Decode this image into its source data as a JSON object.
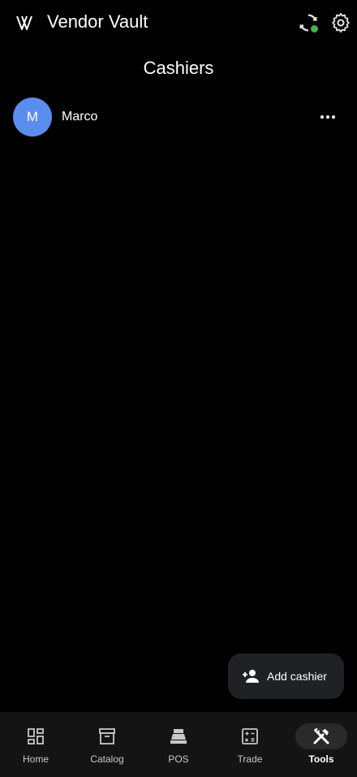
{
  "app": {
    "title": "Vendor Vault",
    "logo_icon": "vendor-vault-logo",
    "sync_icon": "sync-icon",
    "sync_status_color": "#4caf50",
    "settings_icon": "gear-icon"
  },
  "page": {
    "title": "Cashiers"
  },
  "cashiers": [
    {
      "initial": "M",
      "name": "Marco",
      "avatar_color": "#5b8dee",
      "menu_icon": "more-horizontal-icon"
    }
  ],
  "fab": {
    "label": "Add cashier",
    "icon": "person-add-icon"
  },
  "nav": {
    "items": [
      {
        "label": "Home",
        "icon": "dashboard-icon",
        "active": false
      },
      {
        "label": "Catalog",
        "icon": "archive-box-icon",
        "active": false
      },
      {
        "label": "POS",
        "icon": "cash-register-icon",
        "active": false
      },
      {
        "label": "Trade",
        "icon": "calculator-icon",
        "active": false
      },
      {
        "label": "Tools",
        "icon": "tools-icon",
        "active": true
      }
    ]
  }
}
